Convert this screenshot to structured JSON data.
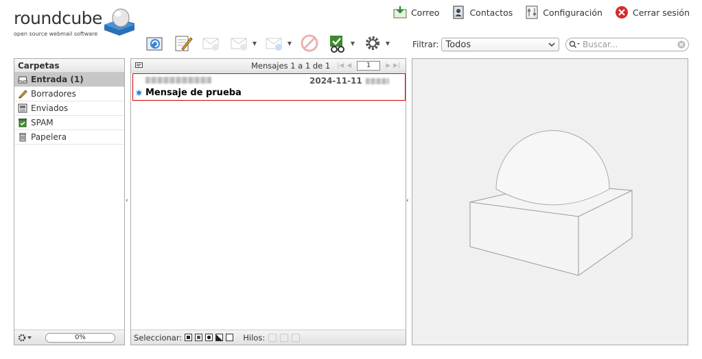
{
  "app": {
    "logo_text": "roundcube",
    "logo_subtitle": "open source webmail software"
  },
  "topnav": [
    {
      "label": "Correo",
      "icon": "mail-download-icon"
    },
    {
      "label": "Contactos",
      "icon": "address-book-icon"
    },
    {
      "label": "Configuración",
      "icon": "settings-icon"
    },
    {
      "label": "Cerrar sesión",
      "icon": "logout-icon"
    }
  ],
  "filter": {
    "label": "Filtrar:",
    "selected": "Todos"
  },
  "search": {
    "placeholder": "Buscar..."
  },
  "folders": {
    "header": "Carpetas",
    "items": [
      {
        "label": "Entrada (1)",
        "icon": "inbox-icon",
        "selected": true
      },
      {
        "label": "Borradores",
        "icon": "pencil-icon"
      },
      {
        "label": "Enviados",
        "icon": "sent-icon"
      },
      {
        "label": "SPAM",
        "icon": "spam-icon"
      },
      {
        "label": "Papelera",
        "icon": "trash-icon"
      }
    ],
    "quota": "0%"
  },
  "messagelist": {
    "count_text": "Mensajes 1 a 1 de 1",
    "page": "1",
    "messages": [
      {
        "date": "2024-11-11",
        "subject": "Mensaje de prueba",
        "unread": true
      }
    ],
    "footer_select_label": "Seleccionar:",
    "footer_threads_label": "Hilos:"
  }
}
